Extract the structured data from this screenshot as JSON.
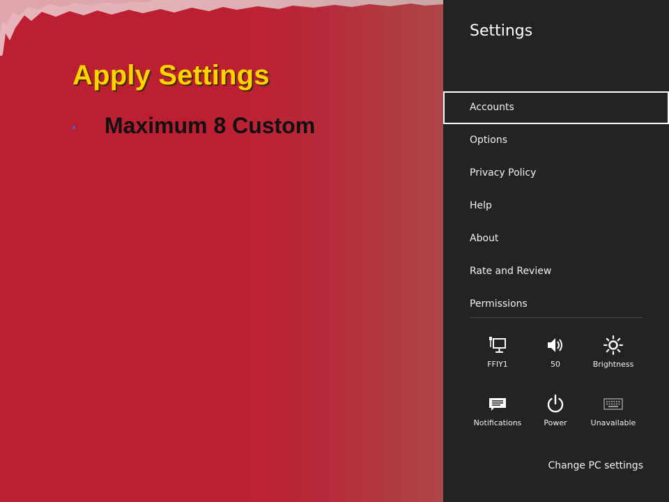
{
  "slide": {
    "title": "Apply Settings",
    "bullets": [
      "Maximum 8 Custom"
    ],
    "colors": {
      "background": "#bd1f32",
      "title": "#ffd200",
      "bullet_dot": "#1e7bd6",
      "bullet_text": "#111111"
    }
  },
  "settings_panel": {
    "title": "Settings",
    "selected_item": "Accounts",
    "menu_items": [
      {
        "label": "Accounts"
      },
      {
        "label": "Options"
      },
      {
        "label": "Privacy Policy"
      },
      {
        "label": "Help"
      },
      {
        "label": "About"
      },
      {
        "label": "Rate and Review"
      },
      {
        "label": "Permissions"
      }
    ],
    "quick_settings": [
      {
        "label": "FFIY1",
        "icon": "network-icon"
      },
      {
        "label": "50",
        "icon": "volume-icon"
      },
      {
        "label": "Brightness",
        "icon": "brightness-icon"
      },
      {
        "label": "Notifications",
        "icon": "notifications-icon"
      },
      {
        "label": "Power",
        "icon": "power-icon"
      },
      {
        "label": "Unavailable",
        "icon": "keyboard-icon"
      }
    ],
    "footer_link": "Change PC settings",
    "colors": {
      "background": "#232323",
      "text": "#f2f2f2",
      "selection_border": "#ffffff"
    }
  }
}
